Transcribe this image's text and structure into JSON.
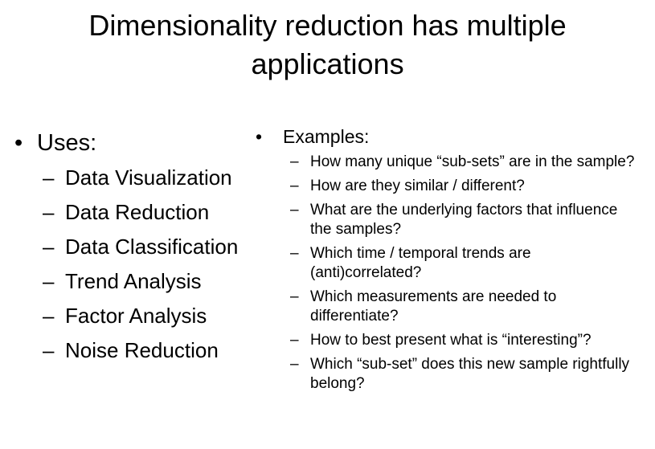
{
  "slide": {
    "title_line1": "Dimensionality reduction has multiple",
    "title_line2": "applications",
    "bullet_glyph": "•",
    "dash_glyph": "–",
    "uses": {
      "heading": "Uses:",
      "items": [
        "Data Visualization",
        "Data Reduction",
        "Data Classification",
        "Trend Analysis",
        "Factor Analysis",
        "Noise Reduction"
      ]
    },
    "examples": {
      "heading": "Examples:",
      "items": [
        "How many unique “sub-sets” are in the sample?",
        "How are they similar / different?",
        "What are the underlying factors that influence the samples?",
        "Which time / temporal trends are (anti)correlated?",
        "Which measurements are needed to differentiate?",
        "How to best present what is “interesting”?",
        "Which “sub-set” does this new sample rightfully belong?"
      ]
    }
  }
}
